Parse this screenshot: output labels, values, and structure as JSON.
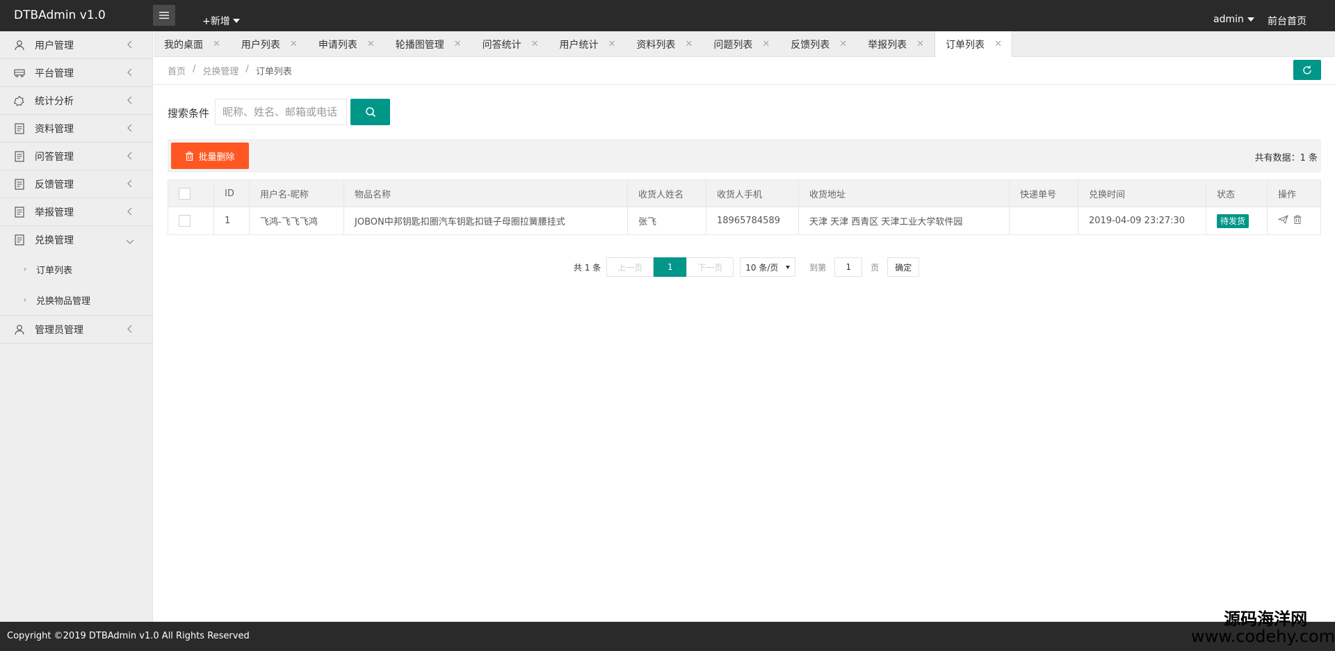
{
  "header": {
    "logo": "DTBAdmin v1.0",
    "add_new": "+新增",
    "user": "admin",
    "front_link": "前台首页"
  },
  "sidebar": {
    "items": [
      {
        "label": "用户管理",
        "icon": "user-icon"
      },
      {
        "label": "平台管理",
        "icon": "bus-icon"
      },
      {
        "label": "统计分析",
        "icon": "chart-icon"
      },
      {
        "label": "资料管理",
        "icon": "document-icon"
      },
      {
        "label": "问答管理",
        "icon": "document-icon"
      },
      {
        "label": "反馈管理",
        "icon": "document-icon"
      },
      {
        "label": "举报管理",
        "icon": "document-icon"
      },
      {
        "label": "兑换管理",
        "icon": "document-icon",
        "expanded": true,
        "children": [
          {
            "label": "订单列表"
          },
          {
            "label": "兑换物品管理"
          }
        ]
      },
      {
        "label": "管理员管理",
        "icon": "user-icon"
      }
    ]
  },
  "tabs": [
    {
      "label": "我的桌面"
    },
    {
      "label": "用户列表"
    },
    {
      "label": "申请列表"
    },
    {
      "label": "轮播图管理"
    },
    {
      "label": "问答统计"
    },
    {
      "label": "用户统计"
    },
    {
      "label": "资料列表"
    },
    {
      "label": "问题列表"
    },
    {
      "label": "反馈列表"
    },
    {
      "label": "举报列表"
    },
    {
      "label": "订单列表",
      "active": true
    }
  ],
  "breadcrumb": {
    "home": "首页",
    "section": "兑换管理",
    "current": "订单列表",
    "separator": "/"
  },
  "search": {
    "label": "搜索条件",
    "placeholder": "昵称、姓名、邮箱或电话"
  },
  "toolbar": {
    "batch_delete": "批量删除",
    "total": "共有数据：1 条"
  },
  "table": {
    "columns": [
      "ID",
      "用户名-昵称",
      "物品名称",
      "收货人姓名",
      "收货人手机",
      "收货地址",
      "快递单号",
      "兑换时间",
      "状态",
      "操作"
    ],
    "rows": [
      {
        "id": "1",
        "user": "飞鸿-飞飞飞鸿",
        "item": "JOBON中邦钥匙扣圈汽车钥匙扣链子母圈拉簧腰挂式",
        "receiver": "张飞",
        "phone": "18965784589",
        "address": "天津 天津 西青区 天津工业大学软件园",
        "tracking": "",
        "time": "2019-04-09 23:27:30",
        "status": "待发货"
      }
    ]
  },
  "pagination": {
    "count": "共 1 条",
    "prev": "上一页",
    "current": "1",
    "next": "下一页",
    "page_size": "10 条/页",
    "goto": "到第",
    "goto_value": "1",
    "page_unit": "页",
    "ok": "确定"
  },
  "footer": {
    "copyright": "Copyright ©2019 DTBAdmin v1.0 All Rights Reserved"
  },
  "watermark": {
    "line1": "源码海洋网",
    "line2": "www.codehy.com"
  },
  "colors": {
    "header_bg": "#2a2a2a",
    "accent": "#009688",
    "danger": "#ff5722",
    "sidebar_bg": "#eeeeee"
  }
}
